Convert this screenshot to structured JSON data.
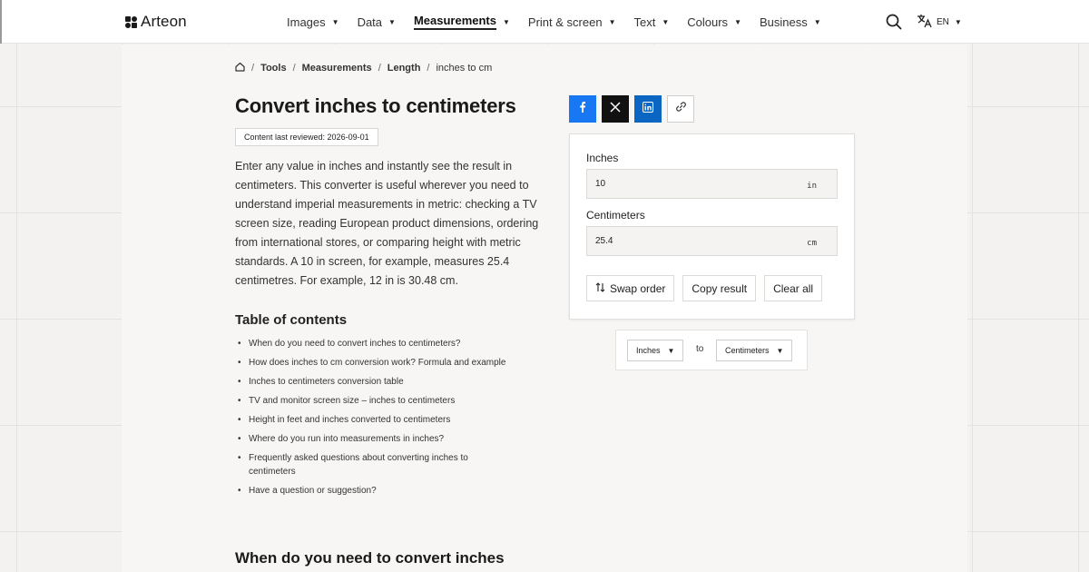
{
  "brand": {
    "name": "Arteon"
  },
  "nav": [
    {
      "label": "Images",
      "active": false
    },
    {
      "label": "Data",
      "active": false
    },
    {
      "label": "Measurements",
      "active": true
    },
    {
      "label": "Print & screen",
      "active": false
    },
    {
      "label": "Text",
      "active": false
    },
    {
      "label": "Colours",
      "active": false
    },
    {
      "label": "Business",
      "active": false
    }
  ],
  "header": {
    "language": "EN",
    "search_icon": "search-icon",
    "translate_icon": "translate-icon"
  },
  "breadcrumb": {
    "home_icon": "home-icon",
    "items": [
      "Tools",
      "Measurements",
      "Length"
    ],
    "current": "inches to cm"
  },
  "page": {
    "title": "Convert inches to centimeters",
    "reviewed": "Content last reviewed: 2026-09-01",
    "intro": "Enter any value in inches and instantly see the result in centimeters. This converter is useful wherever you need to understand imperial measurements in metric: checking a TV screen size, reading European product dimensions, ordering from international stores, or comparing height with metric standards. A 10 in screen, for example, measures 25.4 centimetres. For example, 12 in is 30.48 cm.",
    "toc_title": "Table of contents",
    "toc": [
      "When do you need to convert inches to centimeters?",
      "How does inches to cm conversion work? Formula and example",
      "Inches to centimeters conversion table",
      "TV and monitor screen size – inches to centimeters",
      "Height in feet and inches converted to centimeters",
      "Where do you run into measurements in inches?",
      "Frequently asked questions about converting inches to centimeters",
      "Have a question or suggestion?"
    ],
    "section_title": "When do you need to convert inches to centimeters?"
  },
  "share": [
    "facebook-icon",
    "x-icon",
    "linkedin-icon",
    "link-icon"
  ],
  "converter": {
    "from_label": "Inches",
    "from_value": "10",
    "from_unit": "in",
    "to_label": "Centimeters",
    "to_value": "25.4",
    "to_unit": "cm",
    "swap_label": "Swap order",
    "copy_label": "Copy result",
    "clear_label": "Clear all",
    "unit_from": "Inches",
    "to_word": "to",
    "unit_to": "Centimeters"
  },
  "colors": {
    "facebook": "#1877f2",
    "x": "#111111",
    "linkedin": "#0a66c2"
  }
}
